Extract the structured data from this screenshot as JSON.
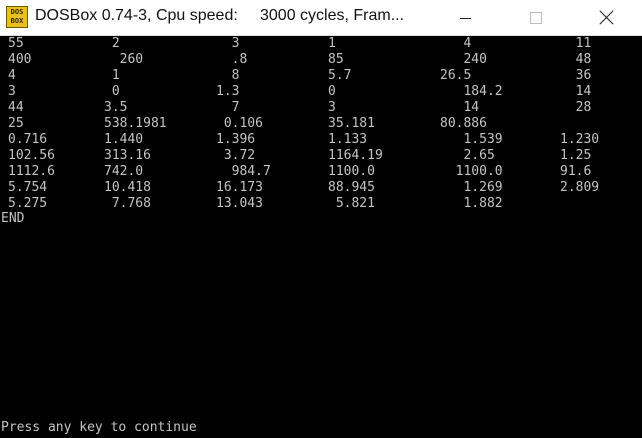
{
  "window": {
    "title": "DOSBox 0.74-3, Cpu speed:     3000 cycles, Fram...",
    "icon_name": "dosbox-icon",
    "icon_text": [
      "DOS",
      "BOX"
    ]
  },
  "controls": {
    "minimize_icon": "minimize-icon",
    "maximize_icon": "maximize-icon",
    "close_icon": "close-icon"
  },
  "console": {
    "rows": [
      [
        "55",
        " 2",
        "  3",
        "1",
        "   4",
        "  11"
      ],
      [
        "400",
        "  260",
        "  .8",
        "85",
        "   240",
        "  48"
      ],
      [
        "4",
        " 1",
        "  8",
        "5.7",
        "26.5",
        "  36"
      ],
      [
        "3",
        " 0",
        "1.3",
        "0",
        "   184.2",
        "  14"
      ],
      [
        "44",
        "3.5",
        "  7",
        "3",
        "   14",
        "  28"
      ],
      [
        "25",
        "538.1981",
        " 0.106",
        "35.181",
        "80.886",
        ""
      ],
      [
        "0.716",
        "1.440",
        "1.396",
        "1.133",
        "   1.539",
        "1.230"
      ],
      [
        "102.56",
        "313.16",
        " 3.72",
        "1164.19",
        "   2.65",
        "1.25"
      ],
      [
        "1112.6",
        "742.0",
        "  984.7",
        "1100.0",
        "  1100.0",
        "91.6"
      ],
      [
        "5.754",
        "10.418",
        "16.173",
        "88.945",
        "   1.269",
        "2.809"
      ],
      [
        "5.275",
        " 7.768",
        "13.043",
        " 5.821",
        "   1.882",
        ""
      ]
    ],
    "end_text": "END",
    "prompt_text": "Press any key to continue"
  },
  "colors": {
    "console_bg": "#000000",
    "console_fg": "#c4c4c4",
    "titlebar_bg": "#ffffff"
  }
}
